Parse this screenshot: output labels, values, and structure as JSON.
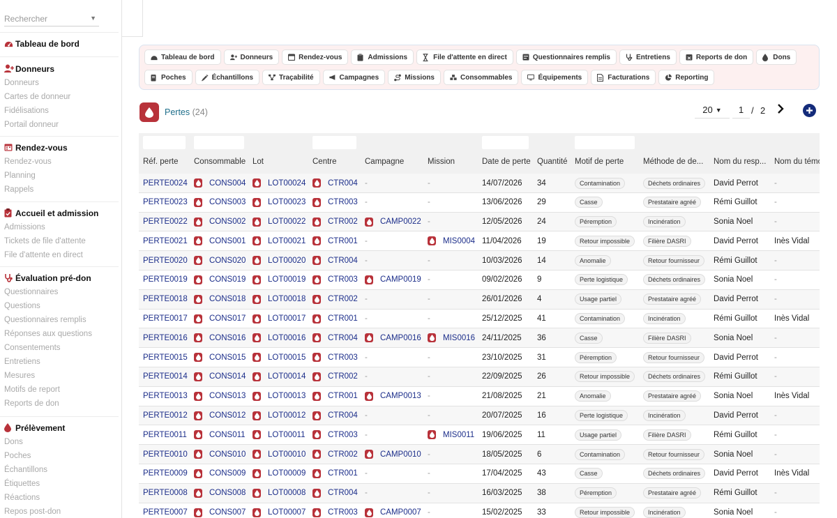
{
  "sidebar": {
    "search_placeholder": "Rechercher",
    "dashboard": "Tableau de bord",
    "sections": [
      {
        "title": "Donneurs",
        "icon": "user-plus-icon",
        "items": [
          "Donneurs",
          "Cartes de donneur",
          "Fidélisations",
          "Portail donneur"
        ]
      },
      {
        "title": "Rendez-vous",
        "icon": "calendar-icon",
        "items": [
          "Rendez-vous",
          "Planning",
          "Rappels"
        ]
      },
      {
        "title": "Accueil et admission",
        "icon": "clipboard-icon",
        "items": [
          "Admissions",
          "Tickets de file d'attente",
          "File d'attente en direct"
        ]
      },
      {
        "title": "Évaluation pré-don",
        "icon": "stethoscope-icon",
        "items": [
          "Questionnaires",
          "Questions",
          "Questionnaires remplis",
          "Réponses aux questions",
          "Consentements",
          "Entretiens",
          "Mesures",
          "Motifs de report",
          "Reports de don"
        ]
      },
      {
        "title": "Prélèvement",
        "icon": "drop-icon",
        "items": [
          "Dons",
          "Poches",
          "Échantillons",
          "Étiquettes",
          "Réactions",
          "Repos post-don"
        ]
      }
    ]
  },
  "modules": {
    "row1": [
      {
        "label": "Tableau de bord",
        "icon": "gauge-icon"
      },
      {
        "label": "Donneurs",
        "icon": "user-plus-icon"
      },
      {
        "label": "Rendez-vous",
        "icon": "calendar-icon"
      },
      {
        "label": "Admissions",
        "icon": "clipboard-icon"
      },
      {
        "label": "File d'attente en direct",
        "icon": "hourglass-icon"
      },
      {
        "label": "Questionnaires remplis",
        "icon": "form-icon"
      },
      {
        "label": "Entretiens",
        "icon": "stethoscope-icon"
      },
      {
        "label": "Reports de don",
        "icon": "calendar-x-icon"
      },
      {
        "label": "Dons",
        "icon": "drop-icon"
      }
    ],
    "row2": [
      {
        "label": "Poches",
        "icon": "bag-icon"
      },
      {
        "label": "Échantillons",
        "icon": "syringe-icon"
      },
      {
        "label": "Traçabilité",
        "icon": "network-icon"
      },
      {
        "label": "Campagnes",
        "icon": "megaphone-icon"
      },
      {
        "label": "Missions",
        "icon": "route-icon"
      },
      {
        "label": "Consommables",
        "icon": "boxes-icon"
      },
      {
        "label": "Équipements",
        "icon": "monitor-icon"
      },
      {
        "label": "Facturations",
        "icon": "invoice-icon"
      },
      {
        "label": "Reporting",
        "icon": "pie-icon"
      }
    ]
  },
  "page": {
    "title": "Pertes",
    "count": "(24)"
  },
  "pager": {
    "page_size": "20",
    "current": "1",
    "sep": "/",
    "total": "2"
  },
  "table": {
    "columns": [
      "Réf. perte",
      "Consommable",
      "Lot",
      "Centre",
      "Campagne",
      "Mission",
      "Date de perte",
      "Quantité",
      "Motif de perte",
      "Méthode de de...",
      "Nom du resp...",
      "Nom du témo"
    ],
    "rows": [
      [
        "PERTE0024",
        "CONS004",
        "LOT00024",
        "CTR004",
        "-",
        "-",
        "14/07/2026",
        "34",
        "Contamination",
        "Déchets ordinaires",
        "David Perrot",
        "-"
      ],
      [
        "PERTE0023",
        "CONS003",
        "LOT00023",
        "CTR003",
        "-",
        "-",
        "13/06/2026",
        "29",
        "Casse",
        "Prestataire agréé",
        "Rémi Guillot",
        "-"
      ],
      [
        "PERTE0022",
        "CONS002",
        "LOT00022",
        "CTR002",
        "CAMP0022",
        "-",
        "12/05/2026",
        "24",
        "Péremption",
        "Incinération",
        "Sonia Noel",
        "-"
      ],
      [
        "PERTE0021",
        "CONS001",
        "LOT00021",
        "CTR001",
        "-",
        "MIS0004",
        "11/04/2026",
        "19",
        "Retour impossible",
        "Filière DASRI",
        "David Perrot",
        "Inès Vidal"
      ],
      [
        "PERTE0020",
        "CONS020",
        "LOT00020",
        "CTR004",
        "-",
        "-",
        "10/03/2026",
        "14",
        "Anomalie",
        "Retour fournisseur",
        "Rémi Guillot",
        "-"
      ],
      [
        "PERTE0019",
        "CONS019",
        "LOT00019",
        "CTR003",
        "CAMP0019",
        "-",
        "09/02/2026",
        "9",
        "Perte logistique",
        "Déchets ordinaires",
        "Sonia Noel",
        "-"
      ],
      [
        "PERTE0018",
        "CONS018",
        "LOT00018",
        "CTR002",
        "-",
        "-",
        "26/01/2026",
        "4",
        "Usage partiel",
        "Prestataire agréé",
        "David Perrot",
        "-"
      ],
      [
        "PERTE0017",
        "CONS017",
        "LOT00017",
        "CTR001",
        "-",
        "-",
        "25/12/2025",
        "41",
        "Contamination",
        "Incinération",
        "Rémi Guillot",
        "Inès Vidal"
      ],
      [
        "PERTE0016",
        "CONS016",
        "LOT00016",
        "CTR004",
        "CAMP0016",
        "MIS0016",
        "24/11/2025",
        "36",
        "Casse",
        "Filière DASRI",
        "Sonia Noel",
        "-"
      ],
      [
        "PERTE0015",
        "CONS015",
        "LOT00015",
        "CTR003",
        "-",
        "-",
        "23/10/2025",
        "31",
        "Péremption",
        "Retour fournisseur",
        "David Perrot",
        "-"
      ],
      [
        "PERTE0014",
        "CONS014",
        "LOT00014",
        "CTR002",
        "-",
        "-",
        "22/09/2025",
        "26",
        "Retour impossible",
        "Déchets ordinaires",
        "Rémi Guillot",
        "-"
      ],
      [
        "PERTE0013",
        "CONS013",
        "LOT00013",
        "CTR001",
        "CAMP0013",
        "-",
        "21/08/2025",
        "21",
        "Anomalie",
        "Prestataire agréé",
        "Sonia Noel",
        "Inès Vidal"
      ],
      [
        "PERTE0012",
        "CONS012",
        "LOT00012",
        "CTR004",
        "-",
        "-",
        "20/07/2025",
        "16",
        "Perte logistique",
        "Incinération",
        "David Perrot",
        "-"
      ],
      [
        "PERTE0011",
        "CONS011",
        "LOT00011",
        "CTR003",
        "-",
        "MIS0011",
        "19/06/2025",
        "11",
        "Usage partiel",
        "Filière DASRI",
        "Rémi Guillot",
        "-"
      ],
      [
        "PERTE0010",
        "CONS010",
        "LOT00010",
        "CTR002",
        "CAMP0010",
        "-",
        "18/05/2025",
        "6",
        "Contamination",
        "Retour fournisseur",
        "Sonia Noel",
        "-"
      ],
      [
        "PERTE0009",
        "CONS009",
        "LOT00009",
        "CTR001",
        "-",
        "-",
        "17/04/2025",
        "43",
        "Casse",
        "Déchets ordinaires",
        "David Perrot",
        "Inès Vidal"
      ],
      [
        "PERTE0008",
        "CONS008",
        "LOT00008",
        "CTR004",
        "-",
        "-",
        "16/03/2025",
        "38",
        "Péremption",
        "Prestataire agréé",
        "Rémi Guillot",
        "-"
      ],
      [
        "PERTE0007",
        "CONS007",
        "LOT00007",
        "CTR003",
        "CAMP0007",
        "-",
        "15/02/2025",
        "33",
        "Retour impossible",
        "Incinération",
        "Sonia Noel",
        "-"
      ]
    ]
  },
  "colors": {
    "accent": "#b8323a",
    "link": "#1c2e8a",
    "title": "#1f6f8b",
    "add": "#142b7a"
  }
}
